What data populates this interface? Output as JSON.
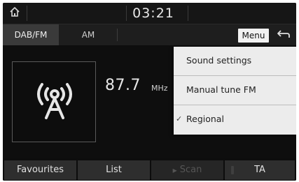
{
  "statusbar": {
    "home_icon": "home-icon",
    "clock": "03:21"
  },
  "tabs": [
    {
      "label": "DAB/FM",
      "active": true
    },
    {
      "label": "AM",
      "active": false
    }
  ],
  "header": {
    "menu_label": "Menu",
    "back_icon": "back-arrow-icon"
  },
  "station": {
    "icon": "radio-antenna-icon",
    "frequency": "87.7",
    "unit": "MHz"
  },
  "menu": {
    "items": [
      {
        "label": "Sound settings",
        "checked": false
      },
      {
        "label": "Manual tune FM",
        "checked": false
      },
      {
        "label": "Regional",
        "checked": true
      }
    ]
  },
  "bottom_bar": {
    "favourites": "Favourites",
    "list": "List",
    "scan": "Scan",
    "scan_enabled": false,
    "ta": "TA",
    "ta_on": false
  },
  "colors": {
    "background": "#0d0d0d",
    "menu_bg": "#ececec",
    "button_bg": "#2e2e2e",
    "text": "#e6e6e6"
  }
}
